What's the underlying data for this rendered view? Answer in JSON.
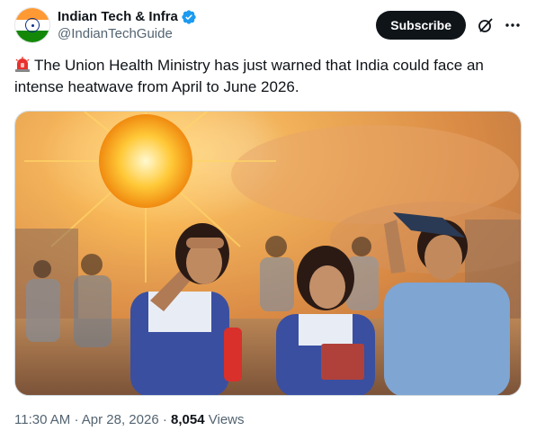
{
  "author": {
    "display_name": "Indian Tech & Infra",
    "handle": "@IndianTechGuide",
    "avatar_icon": "indian-flag-avatar",
    "verified_icon": "verified-badge-icon",
    "avatar_colors": {
      "saffron": "#FF9933",
      "white": "#FFFFFF",
      "green": "#138808",
      "chakra": "#0B2E8A"
    }
  },
  "actions": {
    "subscribe_label": "Subscribe",
    "grok_icon": "grok-icon",
    "more_icon": "more-icon"
  },
  "post": {
    "emoji_icon": "police-siren-icon",
    "text": "The Union Health Ministry has just warned that India could face an intense heatwave from April to June 2026."
  },
  "meta": {
    "time": "11:30 AM",
    "separator": "·",
    "date": "Apr 28, 2026",
    "views_count": "8,054",
    "views_label": "Views"
  },
  "colors": {
    "text_primary": "#0F1419",
    "text_secondary": "#536471",
    "verified_blue": "#1D9BF0",
    "button_dark": "#0F1419"
  }
}
